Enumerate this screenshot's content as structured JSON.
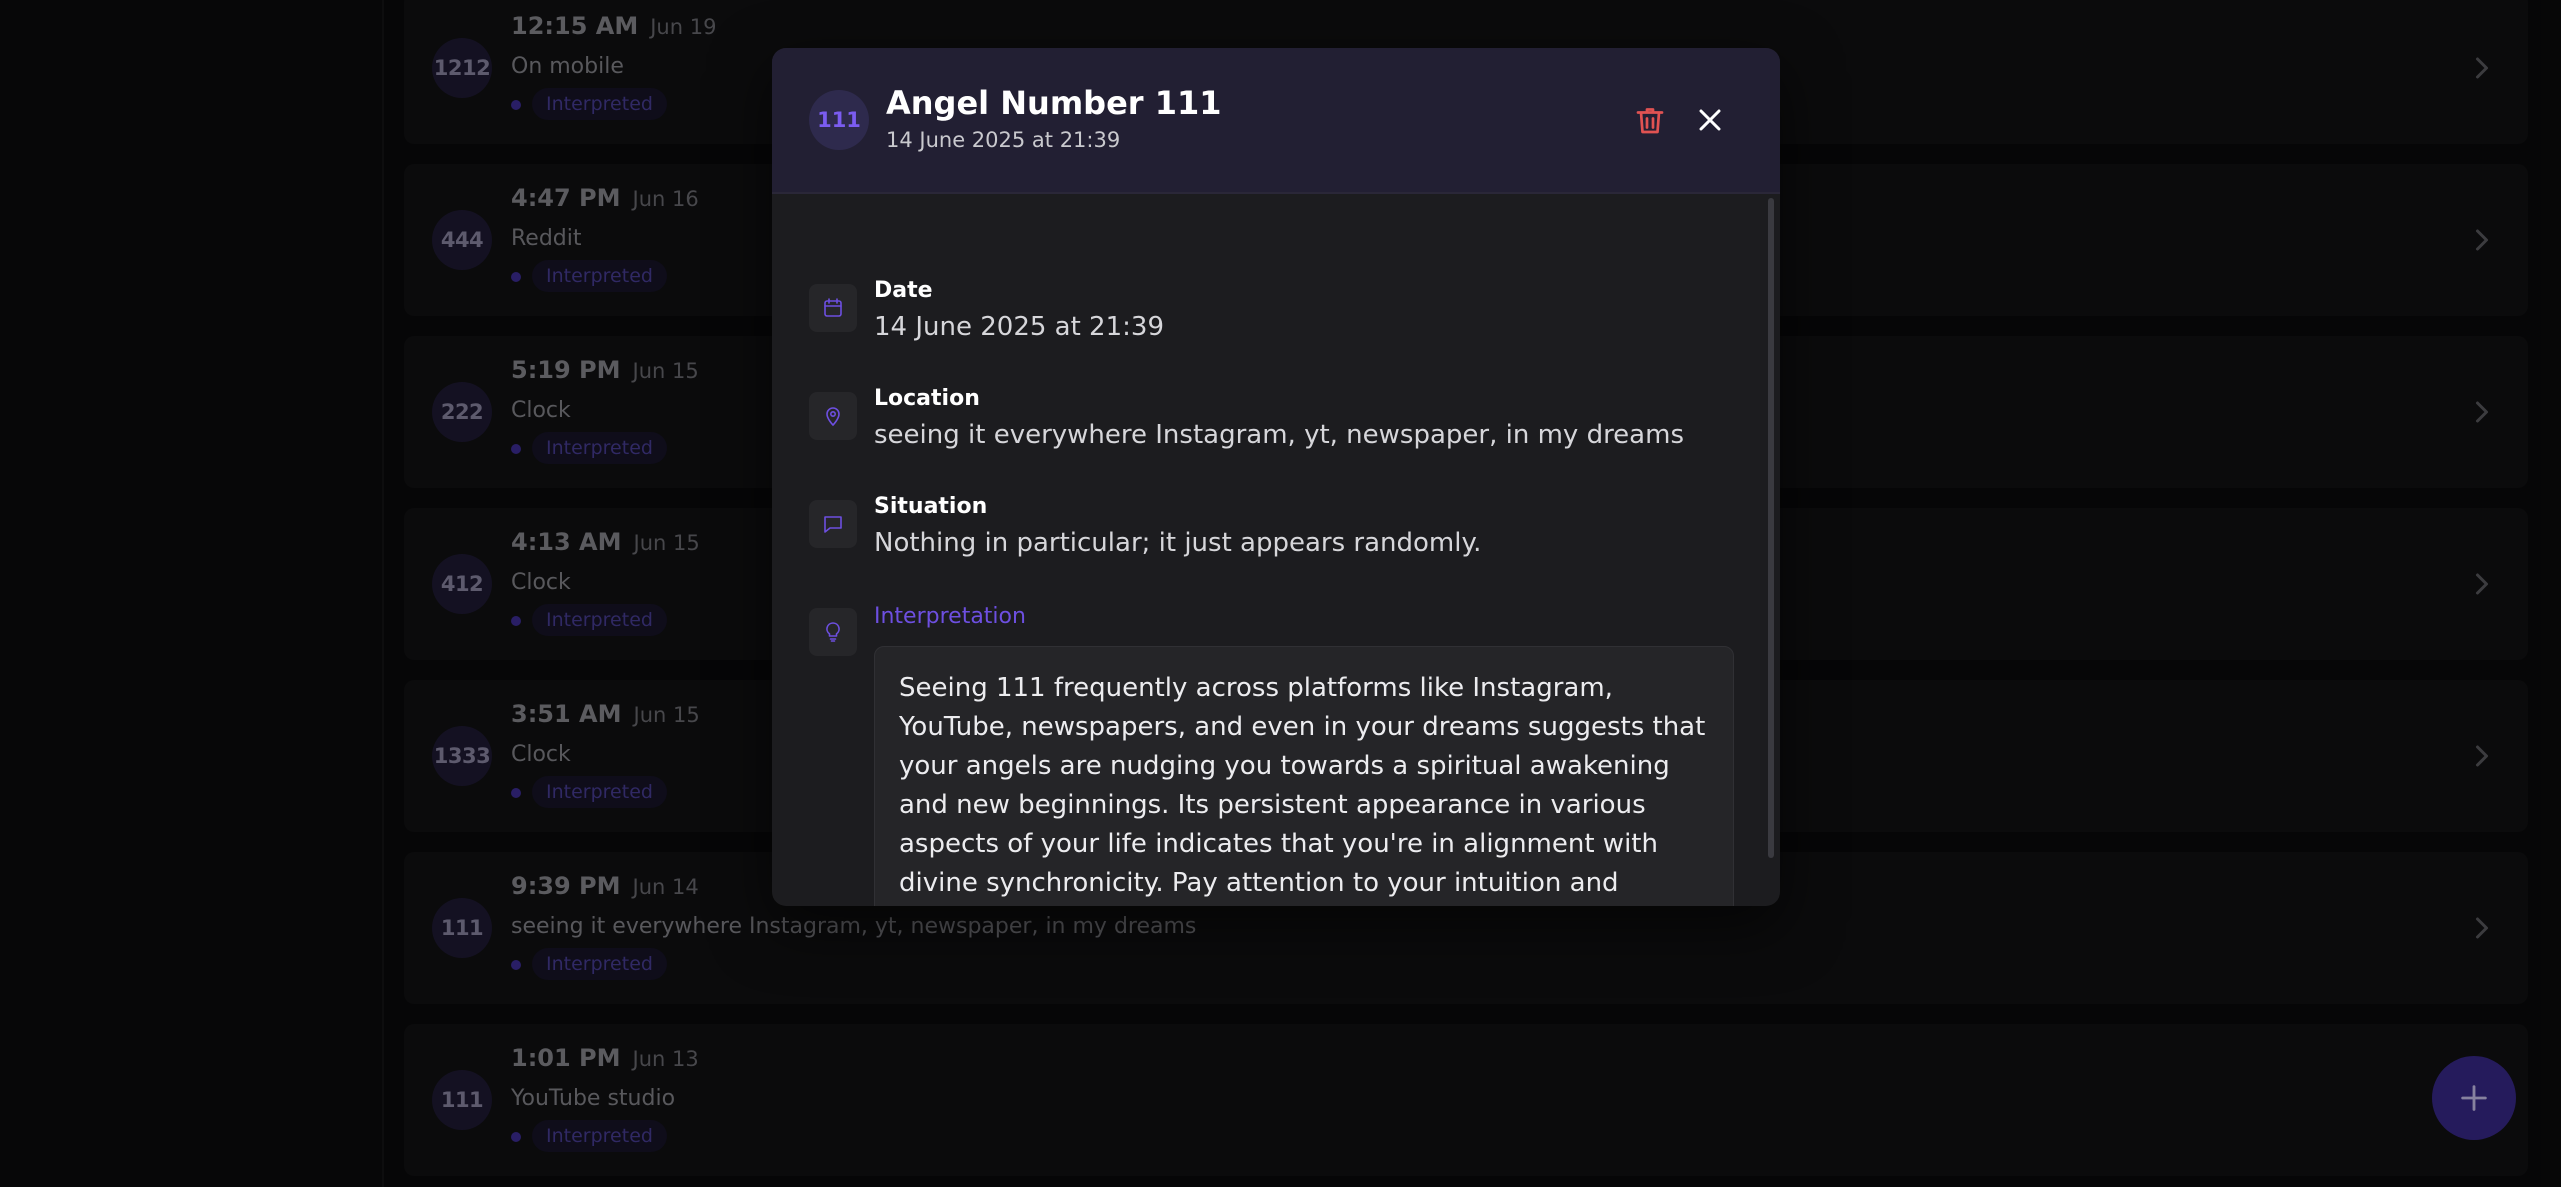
{
  "list": {
    "rows": [
      {
        "number": "1212",
        "time": "12:15 AM",
        "date": "Jun 19",
        "source": "On mobile",
        "status": "Interpreted"
      },
      {
        "number": "444",
        "time": "4:47 PM",
        "date": "Jun 16",
        "source": "Reddit",
        "status": "Interpreted"
      },
      {
        "number": "222",
        "time": "5:19 PM",
        "date": "Jun 15",
        "source": "Clock",
        "status": "Interpreted"
      },
      {
        "number": "412",
        "time": "4:13 AM",
        "date": "Jun 15",
        "source": "Clock",
        "status": "Interpreted"
      },
      {
        "number": "1333",
        "time": "3:51 AM",
        "date": "Jun 15",
        "source": "Clock",
        "status": "Interpreted"
      },
      {
        "number": "111",
        "time": "9:39 PM",
        "date": "Jun 14",
        "source": "seeing it everywhere Instagram, yt, newspaper, in my dreams",
        "status": "Interpreted"
      },
      {
        "number": "111",
        "time": "1:01 PM",
        "date": "Jun 13",
        "source": "YouTube studio",
        "status": "Interpreted"
      }
    ]
  },
  "modal": {
    "badge": "111",
    "title": "Angel Number 111",
    "subtitle": "14 June 2025 at 21:39",
    "fields": {
      "date": {
        "label": "Date",
        "value": "14 June 2025 at 21:39"
      },
      "location": {
        "label": "Location",
        "value": "seeing it everywhere Instagram, yt, newspaper, in my dreams"
      },
      "situation": {
        "label": "Situation",
        "value": "Nothing in particular; it just appears randomly."
      },
      "interpretation": {
        "label": "Interpretation",
        "value": "Seeing 111 frequently across platforms like Instagram, YouTube, newspapers, and even in your dreams suggests that your angels are nudging you towards a spiritual awakening and new beginnings. Its persistent appearance in various aspects of your life indicates that you're in alignment with divine synchronicity. Pay attention to your intuition and explore new opportunities that resonate with you."
      }
    }
  },
  "icons": {
    "row_chevron": "chevron-right-icon",
    "fab": "plus-icon",
    "delete": "trash-icon",
    "close": "close-icon",
    "date": "calendar-icon",
    "location": "map-pin-icon",
    "situation": "message-icon",
    "interpretation": "lightbulb-icon"
  },
  "colors": {
    "accent": "#6d4fe0",
    "delete": "#e05252",
    "fab": "#3a2a8e"
  }
}
